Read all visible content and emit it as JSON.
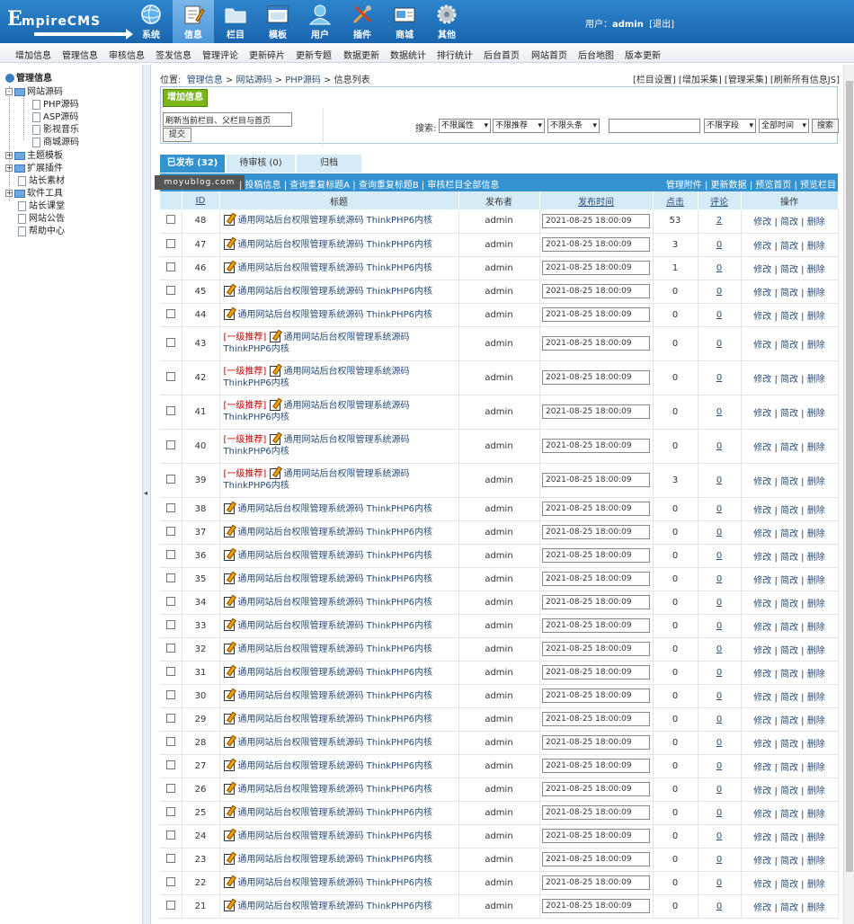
{
  "header": {
    "nav": [
      {
        "label": "系统",
        "icon": "globe-icon"
      },
      {
        "label": "信息",
        "icon": "notepad-icon",
        "active": true
      },
      {
        "label": "栏目",
        "icon": "folder-icon"
      },
      {
        "label": "模板",
        "icon": "window-icon"
      },
      {
        "label": "用户",
        "icon": "user-icon"
      },
      {
        "label": "插件",
        "icon": "tools-icon"
      },
      {
        "label": "商城",
        "icon": "card-icon"
      },
      {
        "label": "其他",
        "icon": "gear-icon"
      }
    ],
    "user_prefix": "用户：",
    "username": "admin",
    "logout": "[退出]"
  },
  "submenu": [
    "增加信息",
    "管理信息",
    "审核信息",
    "签发信息",
    "管理评论",
    "更新碎片",
    "更新专题",
    "数据更新",
    "数据统计",
    "排行统计",
    "后台首页",
    "网站首页",
    "后台地图",
    "版本更新"
  ],
  "tree": {
    "root": "管理信息",
    "site_source": "网站源码",
    "children": [
      "PHP源码",
      "ASP源码",
      "影视音乐",
      "商城源码"
    ],
    "others": [
      "主题模板",
      "扩展插件",
      "站长素材",
      "软件工具",
      "站长课堂",
      "网站公告",
      "帮助中心"
    ]
  },
  "breadcrumb": {
    "prefix": "位置:",
    "items": [
      "管理信息",
      "网站源码",
      "PHP源码",
      "信息列表"
    ]
  },
  "toplinks": "[栏目设置] [增加采集] [管理采集] [刷新所有信息JS]",
  "toolbox": {
    "add_label": "增加信息",
    "refresh_option": "刷新当前栏目、父栏目与首页",
    "submit_label": "提交",
    "search_label": "搜索:",
    "filters": [
      "不限属性",
      "不限推荐",
      "不限头条",
      "不限字段",
      "全部时间"
    ],
    "search_button": "搜索"
  },
  "tabs": [
    "已发布 (32)",
    "待审核 (0)",
    "归档"
  ],
  "actions_left": "| 投稿信息 | 查询重复标题A | 查询重复标题B | 审核栏目全部信息",
  "actions_right": "管理附件 | 更新数据 | 预览首页 | 预览栏目",
  "watermark": "moyublog.com",
  "columns": [
    "ID",
    "标题",
    "发布者",
    "发布时间",
    "点击",
    "评论",
    "操作"
  ],
  "op_labels": [
    "修改",
    "简改",
    "删除"
  ],
  "rows": [
    {
      "id": "48",
      "title": "通用网站后台权限管理系统源码 ThinkPHP6内核",
      "rec": "",
      "author": "admin",
      "time": "2021-08-25 18:00:09",
      "clicks": "53",
      "comments": "2"
    },
    {
      "id": "47",
      "title": "通用网站后台权限管理系统源码 ThinkPHP6内核",
      "rec": "",
      "author": "admin",
      "time": "2021-08-25 18:00:09",
      "clicks": "3",
      "comments": "0"
    },
    {
      "id": "46",
      "title": "通用网站后台权限管理系统源码 ThinkPHP6内核",
      "rec": "",
      "author": "admin",
      "time": "2021-08-25 18:00:09",
      "clicks": "1",
      "comments": "0"
    },
    {
      "id": "45",
      "title": "通用网站后台权限管理系统源码 ThinkPHP6内核",
      "rec": "",
      "author": "admin",
      "time": "2021-08-25 18:00:09",
      "clicks": "0",
      "comments": "0"
    },
    {
      "id": "44",
      "title": "通用网站后台权限管理系统源码 ThinkPHP6内核",
      "rec": "",
      "author": "admin",
      "time": "2021-08-25 18:00:09",
      "clicks": "0",
      "comments": "0"
    },
    {
      "id": "43",
      "title": "通用网站后台权限管理系统源码 ThinkPHP6内核",
      "rec": "[一级推荐]",
      "author": "admin",
      "time": "2021-08-25 18:00:09",
      "clicks": "0",
      "comments": "0"
    },
    {
      "id": "42",
      "title": "通用网站后台权限管理系统源码 ThinkPHP6内核",
      "rec": "[一级推荐]",
      "author": "admin",
      "time": "2021-08-25 18:00:09",
      "clicks": "0",
      "comments": "0"
    },
    {
      "id": "41",
      "title": "通用网站后台权限管理系统源码 ThinkPHP6内核",
      "rec": "[一级推荐]",
      "author": "admin",
      "time": "2021-08-25 18:00:09",
      "clicks": "0",
      "comments": "0"
    },
    {
      "id": "40",
      "title": "通用网站后台权限管理系统源码 ThinkPHP6内核",
      "rec": "[一级推荐]",
      "author": "admin",
      "time": "2021-08-25 18:00:09",
      "clicks": "0",
      "comments": "0"
    },
    {
      "id": "39",
      "title": "通用网站后台权限管理系统源码 ThinkPHP6内核",
      "rec": "[一级推荐]",
      "author": "admin",
      "time": "2021-08-25 18:00:09",
      "clicks": "3",
      "comments": "0"
    },
    {
      "id": "38",
      "title": "通用网站后台权限管理系统源码 ThinkPHP6内核",
      "rec": "",
      "author": "admin",
      "time": "2021-08-25 18:00:09",
      "clicks": "0",
      "comments": "0"
    },
    {
      "id": "37",
      "title": "通用网站后台权限管理系统源码 ThinkPHP6内核",
      "rec": "",
      "author": "admin",
      "time": "2021-08-25 18:00:09",
      "clicks": "0",
      "comments": "0"
    },
    {
      "id": "36",
      "title": "通用网站后台权限管理系统源码 ThinkPHP6内核",
      "rec": "",
      "author": "admin",
      "time": "2021-08-25 18:00:09",
      "clicks": "0",
      "comments": "0"
    },
    {
      "id": "35",
      "title": "通用网站后台权限管理系统源码 ThinkPHP6内核",
      "rec": "",
      "author": "admin",
      "time": "2021-08-25 18:00:09",
      "clicks": "0",
      "comments": "0"
    },
    {
      "id": "34",
      "title": "通用网站后台权限管理系统源码 ThinkPHP6内核",
      "rec": "",
      "author": "admin",
      "time": "2021-08-25 18:00:09",
      "clicks": "0",
      "comments": "0"
    },
    {
      "id": "33",
      "title": "通用网站后台权限管理系统源码 ThinkPHP6内核",
      "rec": "",
      "author": "admin",
      "time": "2021-08-25 18:00:09",
      "clicks": "0",
      "comments": "0"
    },
    {
      "id": "32",
      "title": "通用网站后台权限管理系统源码 ThinkPHP6内核",
      "rec": "",
      "author": "admin",
      "time": "2021-08-25 18:00:09",
      "clicks": "0",
      "comments": "0"
    },
    {
      "id": "31",
      "title": "通用网站后台权限管理系统源码 ThinkPHP6内核",
      "rec": "",
      "author": "admin",
      "time": "2021-08-25 18:00:09",
      "clicks": "0",
      "comments": "0"
    },
    {
      "id": "30",
      "title": "通用网站后台权限管理系统源码 ThinkPHP6内核",
      "rec": "",
      "author": "admin",
      "time": "2021-08-25 18:00:09",
      "clicks": "0",
      "comments": "0"
    },
    {
      "id": "29",
      "title": "通用网站后台权限管理系统源码 ThinkPHP6内核",
      "rec": "",
      "author": "admin",
      "time": "2021-08-25 18:00:09",
      "clicks": "0",
      "comments": "0"
    },
    {
      "id": "28",
      "title": "通用网站后台权限管理系统源码 ThinkPHP6内核",
      "rec": "",
      "author": "admin",
      "time": "2021-08-25 18:00:09",
      "clicks": "0",
      "comments": "0"
    },
    {
      "id": "27",
      "title": "通用网站后台权限管理系统源码 ThinkPHP6内核",
      "rec": "",
      "author": "admin",
      "time": "2021-08-25 18:00:09",
      "clicks": "0",
      "comments": "0"
    },
    {
      "id": "26",
      "title": "通用网站后台权限管理系统源码 ThinkPHP6内核",
      "rec": "",
      "author": "admin",
      "time": "2021-08-25 18:00:09",
      "clicks": "0",
      "comments": "0"
    },
    {
      "id": "25",
      "title": "通用网站后台权限管理系统源码 ThinkPHP6内核",
      "rec": "",
      "author": "admin",
      "time": "2021-08-25 18:00:09",
      "clicks": "0",
      "comments": "0"
    },
    {
      "id": "24",
      "title": "通用网站后台权限管理系统源码 ThinkPHP6内核",
      "rec": "",
      "author": "admin",
      "time": "2021-08-25 18:00:09",
      "clicks": "0",
      "comments": "0"
    },
    {
      "id": "23",
      "title": "通用网站后台权限管理系统源码 ThinkPHP6内核",
      "rec": "",
      "author": "admin",
      "time": "2021-08-25 18:00:09",
      "clicks": "0",
      "comments": "0"
    },
    {
      "id": "22",
      "title": "通用网站后台权限管理系统源码 ThinkPHP6内核",
      "rec": "",
      "author": "admin",
      "time": "2021-08-25 18:00:09",
      "clicks": "0",
      "comments": "0"
    },
    {
      "id": "21",
      "title": "通用网站后台权限管理系统源码 ThinkPHP6内核",
      "rec": "",
      "author": "admin",
      "time": "2021-08-25 18:00:09",
      "clicks": "0",
      "comments": "0"
    }
  ]
}
